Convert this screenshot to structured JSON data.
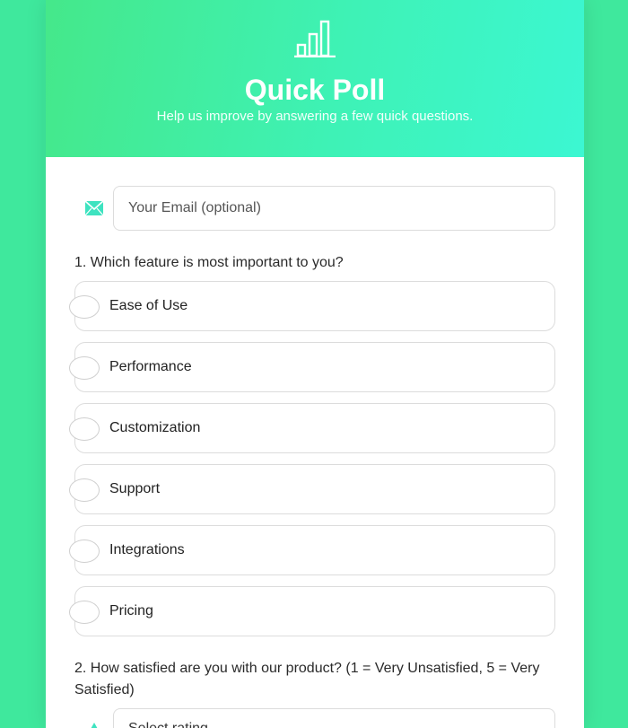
{
  "header": {
    "logo_icon": "bar-chart-icon",
    "title": "Quick Poll",
    "subtitle": "Help us improve by answering a few quick questions."
  },
  "email": {
    "icon": "envelope-icon",
    "placeholder": "Your Email (optional)"
  },
  "question1": {
    "label": "1. Which feature is most important to you?",
    "options": [
      "Ease of Use",
      "Performance",
      "Customization",
      "Support",
      "Integrations",
      "Pricing"
    ]
  },
  "question2": {
    "label": "2. How satisfied are you with our product? (1 = Very Unsatisfied, 5 = Very Satisfied)",
    "icon": "triangle-icon",
    "select_value": "Select rating"
  },
  "colors": {
    "background": "#3fe89d",
    "gradient_start": "#45e88a",
    "gradient_end": "#3cf7d2",
    "accent_icon": "#3ee3c0"
  }
}
